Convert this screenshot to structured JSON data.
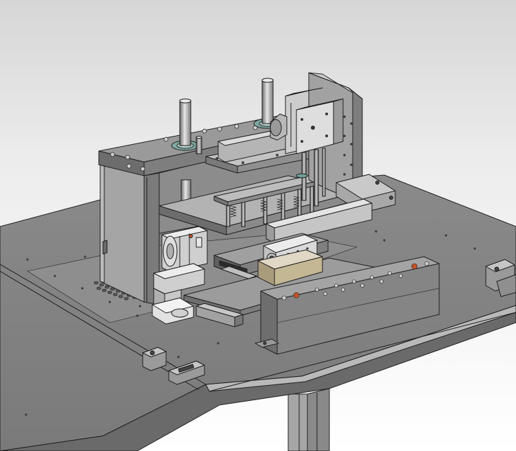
{
  "viewport": {
    "background_top": "#d6d6d6",
    "background_bottom": "#ffffff"
  },
  "model": {
    "body_color": "#8f8f8f",
    "edge_color": "#1e1e1e",
    "highlight_color": "#c8c8c8",
    "steel_color": "#d9d9d9",
    "accent_color": "#c0552a"
  }
}
